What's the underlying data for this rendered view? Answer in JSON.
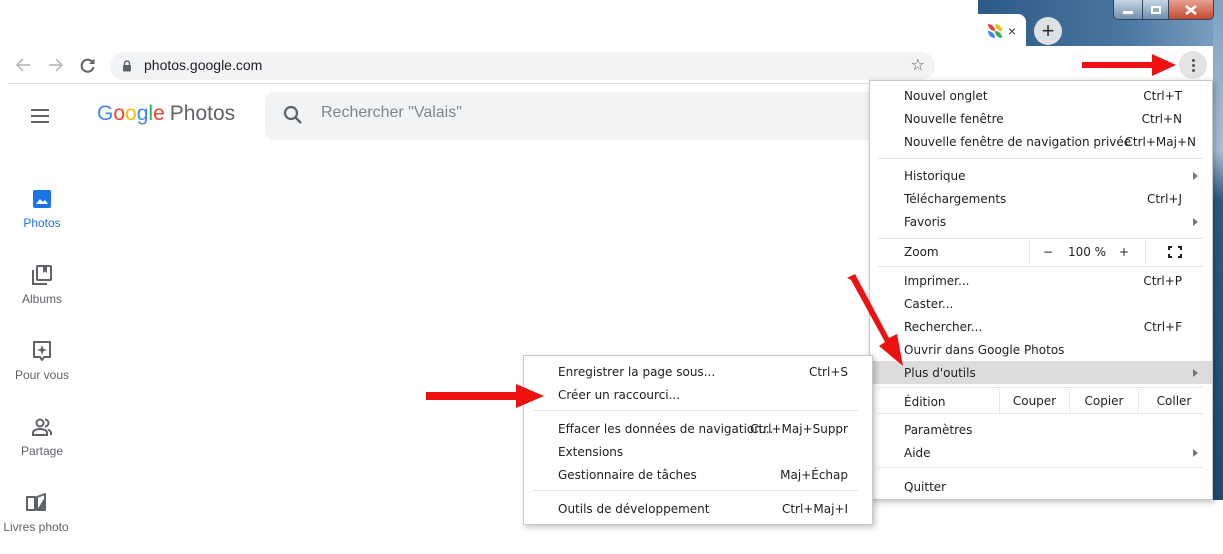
{
  "browser": {
    "url": "photos.google.com",
    "tab": {
      "close_label": "×"
    },
    "new_tab_label": "+",
    "icons": {
      "back": "arrow-left",
      "forward": "arrow-right",
      "reload": "reload",
      "lock": "lock",
      "bookmark": "star",
      "menu": "vertical-dots"
    }
  },
  "page": {
    "logo": {
      "google": [
        "G",
        "o",
        "o",
        "g",
        "l",
        "e"
      ],
      "product": "Photos"
    },
    "logo_colors": [
      "#4285f4",
      "#ea4335",
      "#fbbc05",
      "#4285f4",
      "#34a853",
      "#ea4335"
    ],
    "search_placeholder": "Rechercher \"Valais\"",
    "sidebar": [
      {
        "label": "Photos",
        "icon": "photo-icon",
        "active": true
      },
      {
        "label": "Albums",
        "icon": "albums-icon",
        "active": false
      },
      {
        "label": "Pour vous",
        "icon": "for-you-icon",
        "active": false
      },
      {
        "label": "Partage",
        "icon": "sharing-icon",
        "active": false
      },
      {
        "label": "Livres photo",
        "icon": "photo-books-icon",
        "active": false
      }
    ],
    "accent_color": "#1a73e8"
  },
  "menu": {
    "items": [
      {
        "label": "Nouvel onglet",
        "shortcut": "Ctrl+T"
      },
      {
        "label": "Nouvelle fenêtre",
        "shortcut": "Ctrl+N"
      },
      {
        "label": "Nouvelle fenêtre de navigation privée",
        "shortcut": "Ctrl+Maj+N"
      },
      {
        "label": "Historique",
        "submenu": true
      },
      {
        "label": "Téléchargements",
        "shortcut": "Ctrl+J"
      },
      {
        "label": "Favoris",
        "submenu": true
      },
      {
        "label": "Imprimer...",
        "shortcut": "Ctrl+P"
      },
      {
        "label": "Caster..."
      },
      {
        "label": "Rechercher...",
        "shortcut": "Ctrl+F"
      },
      {
        "label": "Ouvrir dans Google Photos"
      },
      {
        "label": "Plus d'outils",
        "submenu": true,
        "highlighted": true
      },
      {
        "label": "Paramètres"
      },
      {
        "label": "Aide",
        "submenu": true
      },
      {
        "label": "Quitter"
      }
    ],
    "zoom": {
      "label": "Zoom",
      "minus": "−",
      "value": "100 %",
      "plus": "+",
      "fullscreen_icon": "fullscreen"
    },
    "edit": {
      "label": "Édition",
      "cut": "Couper",
      "copy": "Copier",
      "paste": "Coller"
    }
  },
  "submenu": {
    "items": [
      {
        "label": "Enregistrer la page sous...",
        "shortcut": "Ctrl+S"
      },
      {
        "label": "Créer un raccourci..."
      },
      {
        "label": "Effacer les données de navigation...",
        "shortcut": "Ctrl+Maj+Suppr"
      },
      {
        "label": "Extensions"
      },
      {
        "label": "Gestionnaire de tâches",
        "shortcut": "Maj+Échap"
      },
      {
        "label": "Outils de développement",
        "shortcut": "Ctrl+Maj+I"
      }
    ]
  },
  "annotation_color": "#ee1111"
}
